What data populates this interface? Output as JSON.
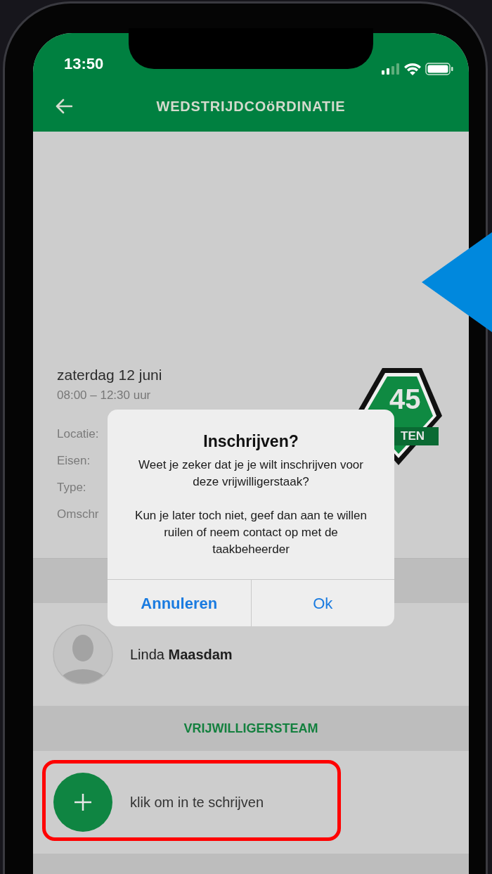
{
  "status_bar": {
    "time": "13:50"
  },
  "header": {
    "title": "WEDSTRIJDCOöRDINATIE"
  },
  "event": {
    "date": "zaterdag 12 juni",
    "time": "08:00 – 12:30 uur",
    "badge": {
      "number": "45",
      "ribbon": "TEN"
    },
    "fields": [
      "Locatie:",
      "Eisen:",
      "Type:",
      "Omschr"
    ]
  },
  "contact": {
    "name": "Linda **Maasdam**"
  },
  "team": {
    "heading": "VRIJWILLIGERSTEAM",
    "add_label": "klik om in te schrijven",
    "highlighted": true
  },
  "dialog": {
    "title": "Inschrijven?",
    "paragraphs": [
      "Weet je zeker dat je je wilt inschrijven voor deze vrijwilligerstaak?",
      "Kun je later toch niet, geef dan aan te willen ruilen of neem contact op met de taakbeheerder"
    ],
    "buttons": [
      {
        "label": "Annuleren",
        "kind": "cancel"
      },
      {
        "label": "Ok",
        "kind": "default"
      }
    ]
  }
}
